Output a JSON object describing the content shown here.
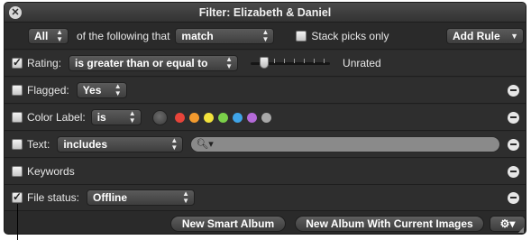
{
  "window": {
    "title": "Filter: Elizabeth & Daniel"
  },
  "header": {
    "match_scope": "All",
    "mid_text": "of the following that",
    "match_mode": "match",
    "stack_picks_label": "Stack picks only",
    "stack_picks_checked": false,
    "add_rule_label": "Add Rule"
  },
  "rules": {
    "rating": {
      "label": "Rating:",
      "checked": true,
      "operator": "is greater than or equal to",
      "value_text": "Unrated",
      "slider_level": 0
    },
    "flagged": {
      "label": "Flagged:",
      "checked": false,
      "value": "Yes"
    },
    "color_label": {
      "label": "Color Label:",
      "checked": false,
      "operator": "is",
      "colors": [
        "#e8443a",
        "#f39a2e",
        "#f2e23c",
        "#7bd04a",
        "#3fa4e8",
        "#b46ad8",
        "#a8a8a8"
      ]
    },
    "text": {
      "label": "Text:",
      "checked": false,
      "operator": "includes",
      "search_value": ""
    },
    "keywords": {
      "label": "Keywords",
      "checked": false
    },
    "file_status": {
      "label": "File status:",
      "checked": true,
      "value": "Offline"
    }
  },
  "footer": {
    "new_smart_album_label": "New Smart Album",
    "new_album_current_label": "New Album With Current Images",
    "action_icon": "gear-icon"
  }
}
